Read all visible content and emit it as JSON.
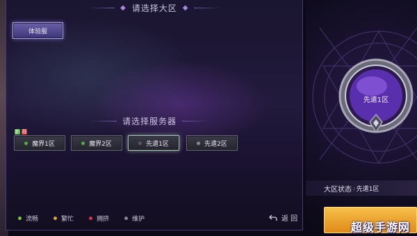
{
  "region_header": "请选择大区",
  "region_button": "体验服",
  "server_header": "请选择服务器",
  "tags": [
    "新",
    "荐"
  ],
  "servers": [
    {
      "label": "魔界1区",
      "status_color": "#4fae4b",
      "selected": false
    },
    {
      "label": "魔界2区",
      "status_color": "#4fae4b",
      "selected": false
    },
    {
      "label": "先遣1区",
      "status_color": "#5a5a5a",
      "selected": true
    },
    {
      "label": "先遣2区",
      "status_color": "#8a8a8a",
      "selected": false
    }
  ],
  "legend": [
    {
      "label": "流畅",
      "color": "#79c93e"
    },
    {
      "label": "繁忙",
      "color": "#d9a53a"
    },
    {
      "label": "拥挤",
      "color": "#d5384a"
    },
    {
      "label": "维护",
      "color": "#8a8a8a"
    }
  ],
  "back_label": "返 回",
  "orb_label": "先遣1区",
  "status": {
    "label": "大区状态",
    "value": "先遣1区"
  },
  "watermark": "超级手游网"
}
